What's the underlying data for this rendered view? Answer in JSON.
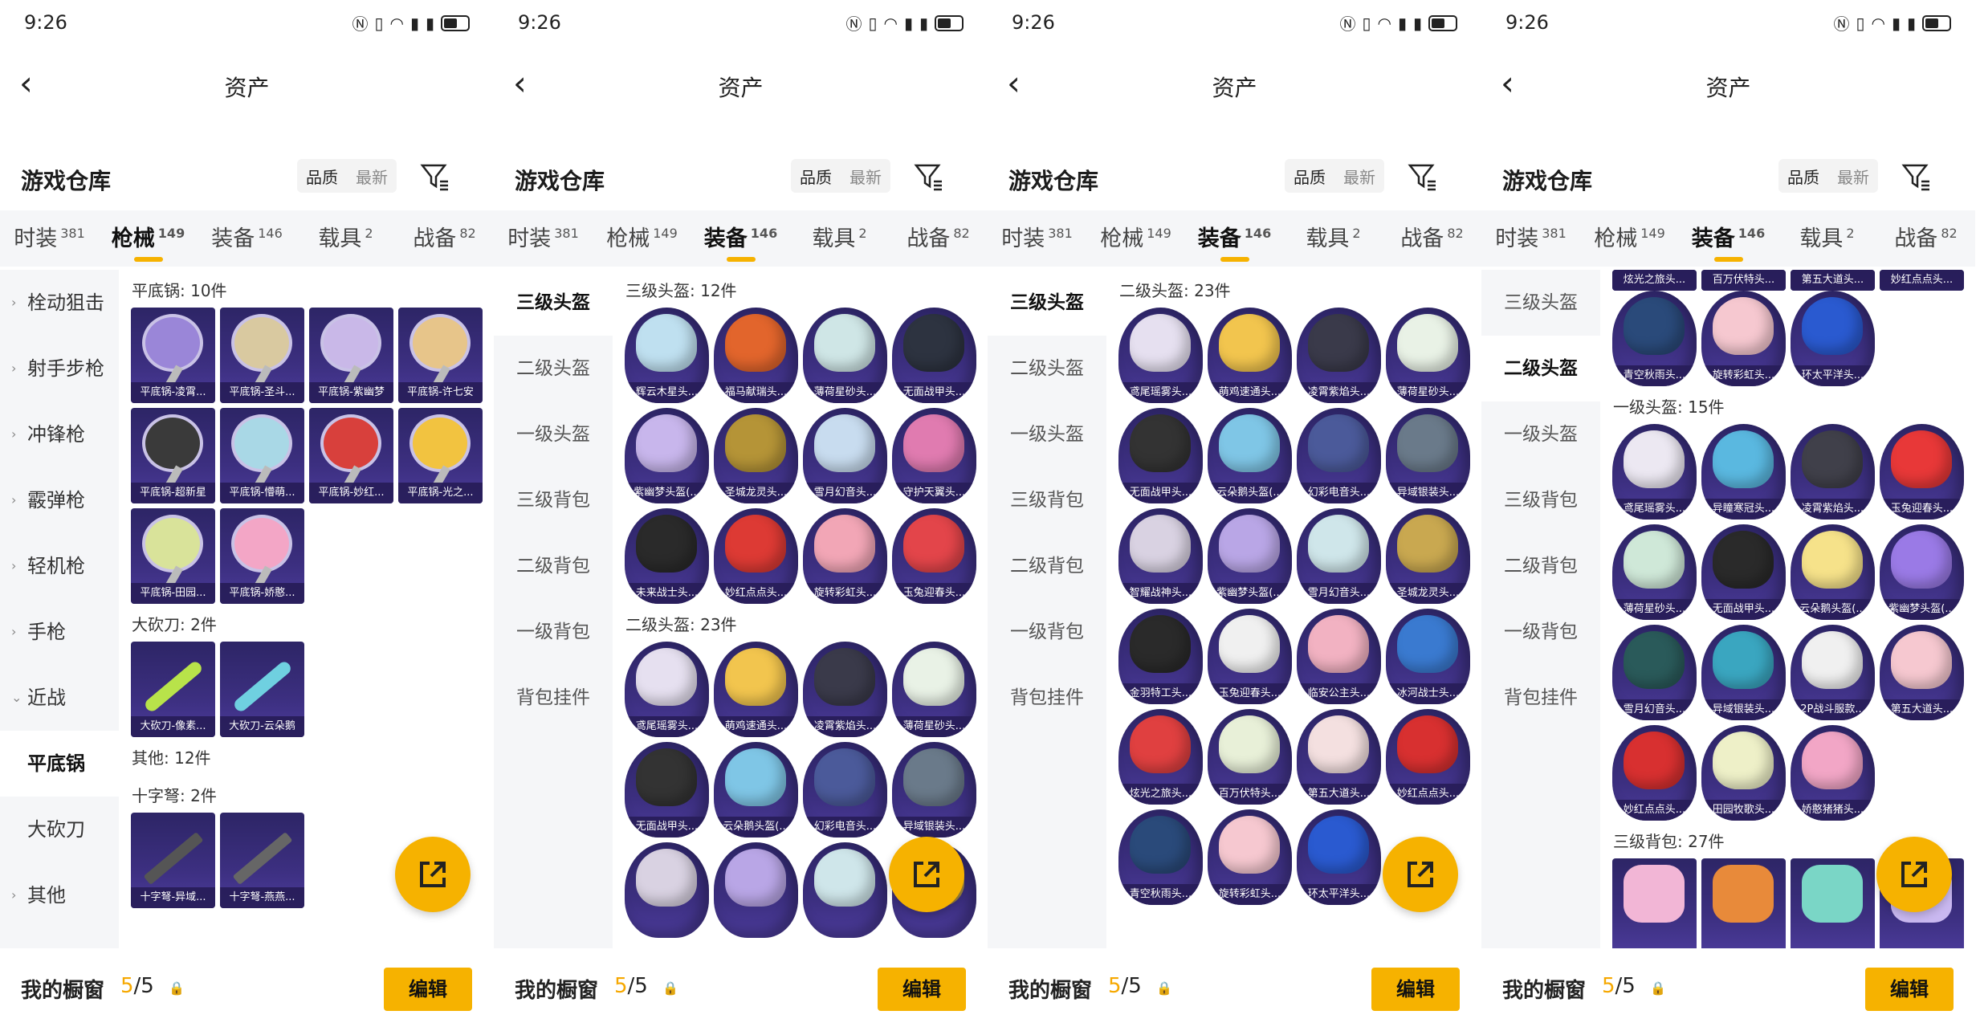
{
  "colors": {
    "accent": "#f6b200",
    "card_bg": "#3c2f80",
    "tabbar_bg": "#f5f6f8"
  },
  "common": {
    "time": "9:26",
    "nav_title": "资产",
    "warehouse_title": "游戏仓库",
    "sort_quality": "品质",
    "sort_latest": "最新",
    "tabs": [
      {
        "label": "时装",
        "count": "381"
      },
      {
        "label": "枪械",
        "count": "149"
      },
      {
        "label": "装备",
        "count": "146"
      },
      {
        "label": "载具",
        "count": "2"
      },
      {
        "label": "战备",
        "count": "82"
      }
    ],
    "showcase_label": "我的橱窗",
    "showcase_used": "5",
    "showcase_total": "/5",
    "edit_label": "编辑"
  },
  "panels": [
    {
      "active_tab": 1,
      "side": [
        {
          "label": "栓动狙击",
          "arrow": "›"
        },
        {
          "label": "射手步枪",
          "arrow": "›"
        },
        {
          "label": "冲锋枪",
          "arrow": "›"
        },
        {
          "label": "霰弹枪",
          "arrow": "›"
        },
        {
          "label": "轻机枪",
          "arrow": "›"
        },
        {
          "label": "手枪",
          "arrow": "›"
        },
        {
          "label": "近战",
          "arrow": "⌄"
        },
        {
          "label": "平底锅",
          "arrow": ""
        },
        {
          "label": "大砍刀",
          "arrow": ""
        },
        {
          "label": "其他",
          "arrow": "›"
        }
      ],
      "side_selected": 7,
      "sections": [
        {
          "title": "平底锅: 10件",
          "kind": "pan",
          "items": [
            "平底锅-凌霄...",
            "平底锅-圣斗...",
            "平底锅-紫幽梦",
            "平底锅-许七安",
            "平底锅-超新星",
            "平底锅-懵萌...",
            "平底锅-妙红...",
            "平底锅-光之...",
            "平底锅-田园...",
            "平底锅-娇憨..."
          ],
          "colors": [
            "#9a86d8",
            "#d9c9a0",
            "#c9b8e8",
            "#e7c58a",
            "#3a3a3a",
            "#a9d8e6",
            "#d8403c",
            "#f2c340",
            "#d9e39a",
            "#f3a6c6"
          ]
        },
        {
          "title": "大砍刀: 2件",
          "kind": "knife",
          "items": [
            "大砍刀-像素...",
            "大砍刀-云朵鹅"
          ],
          "colors": [
            "#b8e34a",
            "#6fd0e0"
          ]
        },
        {
          "title": "其他: 12件",
          "kind": "none",
          "items": [],
          "colors": []
        },
        {
          "title": "十字弩: 2件",
          "kind": "xbow",
          "items": [
            "十字弩-异域...",
            "十字弩-燕燕..."
          ],
          "colors": [
            "#555",
            "#666"
          ]
        }
      ]
    },
    {
      "active_tab": 2,
      "side": [
        {
          "label": "三级头盔"
        },
        {
          "label": "二级头盔"
        },
        {
          "label": "一级头盔"
        },
        {
          "label": "三级背包"
        },
        {
          "label": "二级背包"
        },
        {
          "label": "一级背包"
        },
        {
          "label": "背包挂件"
        }
      ],
      "side_selected": 0,
      "sections": [
        {
          "title": "三级头盔: 12件",
          "kind": "helm",
          "items": [
            "辉云木星头...",
            "福马献瑞头...",
            "薄荷星砂头...",
            "无面战甲头...",
            "紫幽梦头盔(...",
            "圣城龙灵头...",
            "雪月幻音头...",
            "守护天翼头...",
            "未来战士头...",
            "妙红点点头...",
            "旋转彩虹头...",
            "玉兔迎春头..."
          ],
          "colors": [
            "#bfe0f0",
            "#e2652c",
            "#cfe6e6",
            "#2d3340",
            "#c8b6ec",
            "#b59437",
            "#c8dcef",
            "#e07bb0",
            "#2a2a2a",
            "#dd3a34",
            "#f2a6b6",
            "#e3454a"
          ]
        },
        {
          "title": "二级头盔: 23件",
          "kind": "helm",
          "items": [
            "鸢尾瑶雾头...",
            "萌鸡速通头...",
            "凌霄紫焰头...",
            "薄荷星砂头...",
            "无面战甲头...",
            "云朵鹅头盔(...",
            "幻彩电音头...",
            "异域银装头...",
            "",
            "",
            "",
            ""
          ],
          "colors": [
            "#e6e0f0",
            "#f2c54e",
            "#3a3a4a",
            "#e9f2e6",
            "#333",
            "#7fc6e6",
            "#4b5a9a",
            "#6a7a8a",
            "#d9d2e2",
            "#b9a6e6",
            "#cfe6ea",
            "#c9a850"
          ]
        }
      ]
    },
    {
      "active_tab": 2,
      "side": [
        {
          "label": "三级头盔"
        },
        {
          "label": "二级头盔"
        },
        {
          "label": "一级头盔"
        },
        {
          "label": "三级背包"
        },
        {
          "label": "二级背包"
        },
        {
          "label": "一级背包"
        },
        {
          "label": "背包挂件"
        }
      ],
      "side_selected": 0,
      "sections": [
        {
          "title": "二级头盔: 23件",
          "kind": "helm",
          "items": [
            "鸢尾瑶雾头...",
            "萌鸡速通头...",
            "凌霄紫焰头...",
            "薄荷星砂头...",
            "无面战甲头...",
            "云朵鹅头盔(...",
            "幻彩电音头...",
            "异域银装头...",
            "智耀战神头...",
            "紫幽梦头盔(...",
            "雪月幻音头...",
            "圣城龙灵头...",
            "金羽特工头...",
            "玉兔迎春头...",
            "临安公主头...",
            "冰河战士头...",
            "炫光之旅头...",
            "百万伏特头...",
            "第五大道头...",
            "妙红点点头...",
            "青空秋雨头...",
            "旋转彩虹头...",
            "环太平洋头..."
          ],
          "colors": [
            "#e6e0f0",
            "#f2c54e",
            "#3a3a4a",
            "#e9f2e6",
            "#333",
            "#7fc6e6",
            "#4b5a9a",
            "#6a7a8a",
            "#d9d2e2",
            "#b9a6e6",
            "#cfe6ea",
            "#c9a850",
            "#2a2a2a",
            "#f0f0f0",
            "#f2b2c2",
            "#3a7ad0",
            "#e04040",
            "#e8f0d8",
            "#f4e0e0",
            "#d83030",
            "#2a4a7a",
            "#f6c8d0",
            "#2a5ad0"
          ]
        }
      ]
    },
    {
      "active_tab": 2,
      "side": [
        {
          "label": "三级头盔"
        },
        {
          "label": "二级头盔"
        },
        {
          "label": "一级头盔"
        },
        {
          "label": "三级背包"
        },
        {
          "label": "二级背包"
        },
        {
          "label": "一级背包"
        },
        {
          "label": "背包挂件"
        }
      ],
      "side_selected": 1,
      "top_strip": [
        "炫光之旅头...",
        "百万伏特头...",
        "第五大道头...",
        "妙红点点头..."
      ],
      "sections": [
        {
          "title": "",
          "kind": "helm",
          "items": [
            "青空秋雨头...",
            "旋转彩虹头...",
            "环太平洋头..."
          ],
          "colors": [
            "#2a4a7a",
            "#f6c8d0",
            "#2a5ad0"
          ]
        },
        {
          "title": "一级头盔: 15件",
          "kind": "helm",
          "items": [
            "鸢尾瑶雾头...",
            "异瞳寒冠头...",
            "凌霄紫焰头...",
            "玉兔迎春头...",
            "薄荷星砂头...",
            "无面战甲头...",
            "云朵鹅头盔(...",
            "紫幽梦头盔(...",
            "雪月幻音头...",
            "异域银装头...",
            "2P战斗服款...",
            "第五大道头...",
            "妙红点点头...",
            "田园牧歌头...",
            "娇憨猪猪头..."
          ],
          "colors": [
            "#ece8f2",
            "#5ab8e0",
            "#40404a",
            "#e83838",
            "#cfe8d8",
            "#2a2a2a",
            "#f6e28a",
            "#9a7ae6",
            "#2a5a5a",
            "#3aa6c0",
            "#f0f0f0",
            "#f6c8d0",
            "#d83030",
            "#eef0c8",
            "#f2a6c6"
          ]
        },
        {
          "title": "三级背包: 27件",
          "kind": "bag",
          "items": [
            "",
            "",
            "",
            ""
          ],
          "colors": [
            "#f2b6d6",
            "#e88a3a",
            "#7ad6c6",
            "#c9b8f0"
          ]
        }
      ]
    }
  ]
}
